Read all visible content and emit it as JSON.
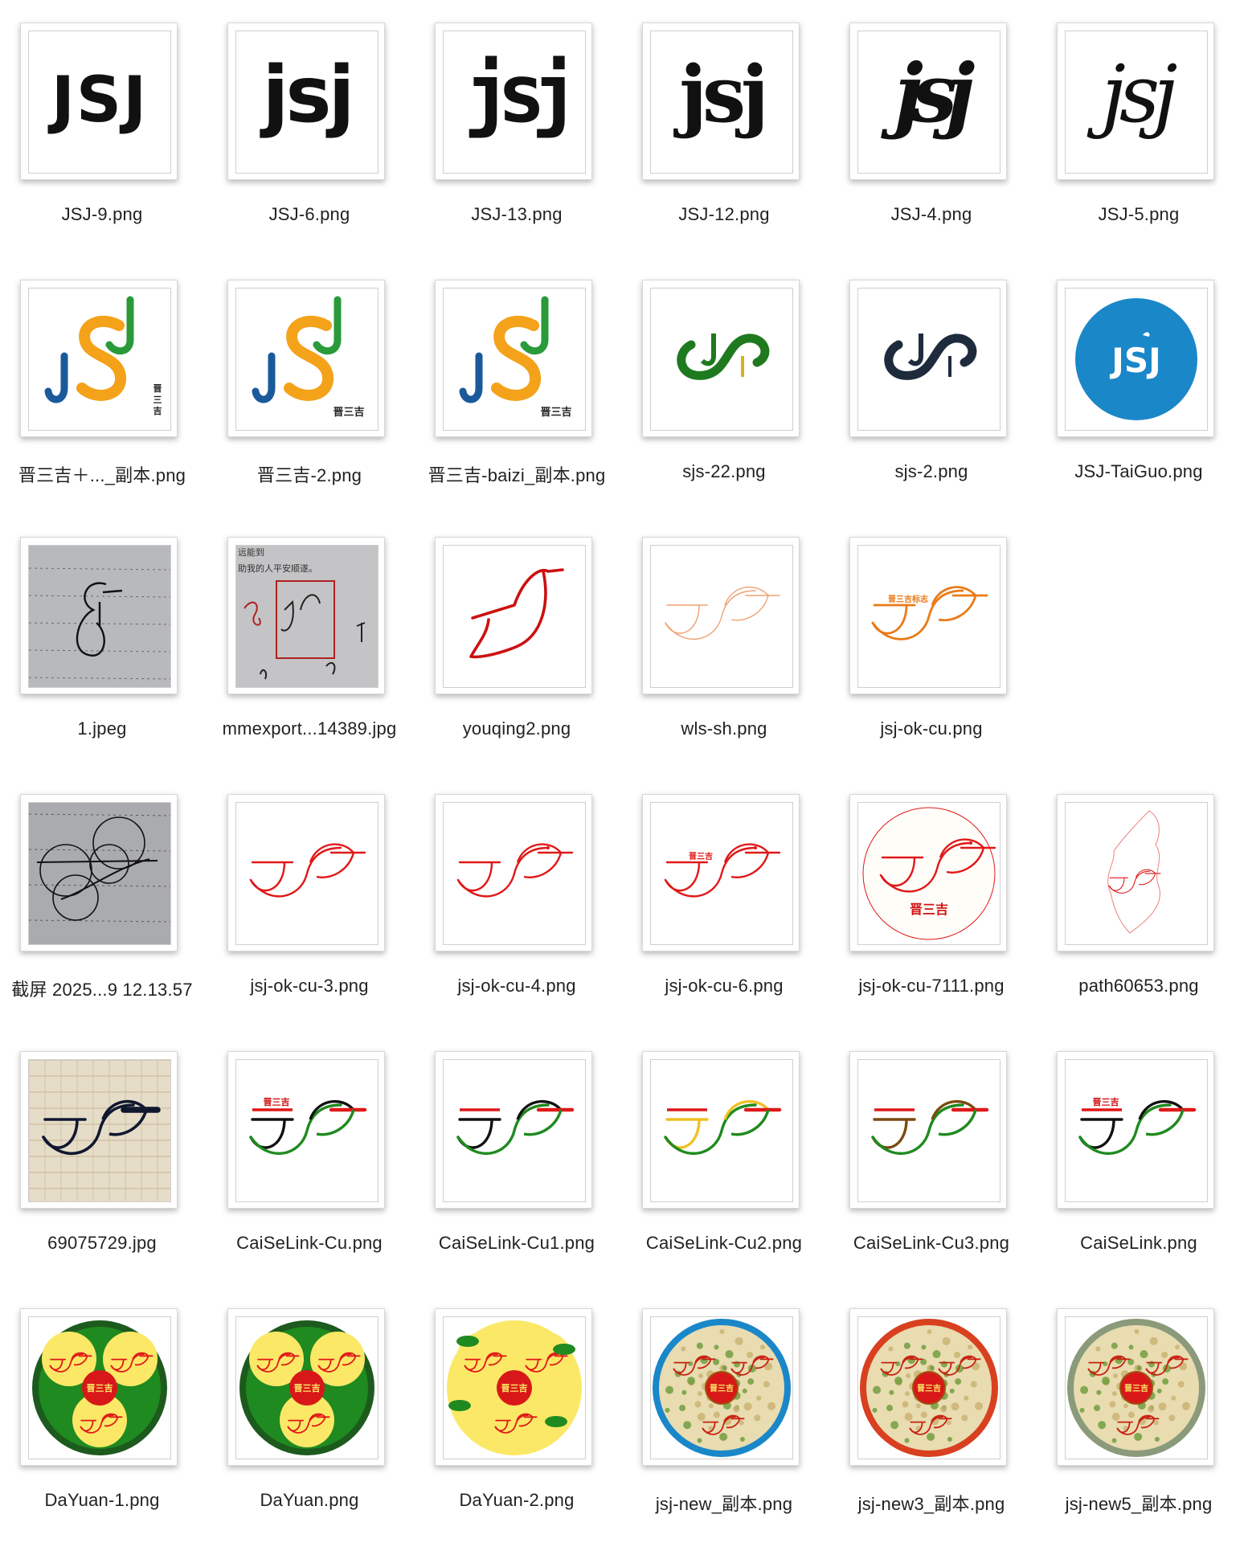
{
  "files": [
    {
      "name": "JSJ-9.png",
      "icon": "jsj-bold-logo-icon",
      "thumb": "text",
      "text": "JSJ",
      "style": "blocky",
      "color": "#111111"
    },
    {
      "name": "JSJ-6.png",
      "icon": "jsj-heavy-lowercase-logo-icon",
      "thumb": "text",
      "text": "jsj",
      "style": "heavy",
      "color": "#111111"
    },
    {
      "name": "JSJ-13.png",
      "icon": "jsj-condensed-logo-icon",
      "thumb": "text",
      "text": "jsj",
      "style": "condensed",
      "color": "#111111"
    },
    {
      "name": "JSJ-12.png",
      "icon": "jsj-rounded-logo-icon",
      "thumb": "text",
      "text": "jsj",
      "style": "rounded",
      "color": "#111111"
    },
    {
      "name": "JSJ-4.png",
      "icon": "jsj-script-logo-icon",
      "thumb": "text",
      "text": "jsj",
      "style": "script",
      "color": "#111111"
    },
    {
      "name": "JSJ-5.png",
      "icon": "jsj-light-script-logo-icon",
      "thumb": "text",
      "text": "jsj",
      "style": "light",
      "color": "#111111"
    },
    {
      "name": "晋三吉＋..._副本.png",
      "icon": "jsj-colored-letters-icon",
      "thumb": "colorjs",
      "caption": "晋三吉",
      "vertical": true
    },
    {
      "name": "晋三吉-2.png",
      "icon": "jsj-colored-letters-icon",
      "thumb": "colorjs",
      "caption": "晋三吉",
      "vertical": false
    },
    {
      "name": "晋三吉-baizi_副本.png",
      "icon": "jsj-colored-letters-icon",
      "thumb": "colorjs",
      "caption": "晋三吉",
      "vertical": false
    },
    {
      "name": "sjs-22.png",
      "icon": "sjs-green-logo-icon",
      "thumb": "sjs",
      "color": "#1f7a1f",
      "accent": "#d8b020"
    },
    {
      "name": "sjs-2.png",
      "icon": "sjs-navy-logo-icon",
      "thumb": "sjs",
      "color": "#1e2b3c",
      "accent": "#1e2b3c"
    },
    {
      "name": "JSJ-TaiGuo.png",
      "icon": "jsj-blue-circle-logo-icon",
      "thumb": "circletext",
      "text": "JSJ",
      "color": "#1a87c9"
    },
    {
      "name": "1.jpeg",
      "icon": "handwritten-sketch-photo-icon",
      "thumb": "photo"
    },
    {
      "name": "mmexport...14389.jpg",
      "icon": "notebook-sketch-photo-icon",
      "thumb": "photo2"
    },
    {
      "name": "youqing2.png",
      "icon": "red-bird-outline-icon",
      "thumb": "redbird"
    },
    {
      "name": "wls-sh.png",
      "icon": "orange-thin-bird-icon",
      "thumb": "bird",
      "color": "#f0a070",
      "width": 1.4
    },
    {
      "name": "jsj-ok-cu.png",
      "icon": "orange-bird-logo-icon",
      "thumb": "bird",
      "color": "#ea7a18",
      "width": 2.8,
      "caption": "晋三吉标志"
    },
    null,
    {
      "name": "截屏 2025...9 12.13.57",
      "icon": "circles-sketch-photo-icon",
      "thumb": "circlesphoto"
    },
    {
      "name": "jsj-ok-cu-3.png",
      "icon": "red-bird-logo-icon",
      "thumb": "bird",
      "color": "#e01818",
      "width": 2.4
    },
    {
      "name": "jsj-ok-cu-4.png",
      "icon": "red-bird-logo-icon",
      "thumb": "bird",
      "color": "#e01818",
      "width": 2.4,
      "eye": true
    },
    {
      "name": "jsj-ok-cu-6.png",
      "icon": "red-bird-logo-icon",
      "thumb": "bird",
      "color": "#e01818",
      "width": 2.4,
      "eye": true,
      "caption": "晋三吉"
    },
    {
      "name": "jsj-ok-cu-7111.png",
      "icon": "red-bird-seal-icon",
      "thumb": "birdcircle",
      "color": "#e01818",
      "caption": "晋三吉"
    },
    {
      "name": "path60653.png",
      "icon": "map-outline-icon",
      "thumb": "map"
    },
    {
      "name": "69075729.jpg",
      "icon": "ink-sketch-photo-icon",
      "thumb": "inkphoto"
    },
    {
      "name": "CaiSeLink-Cu.png",
      "icon": "color-link-bird-icon",
      "thumb": "colorbird",
      "colors": [
        "#111111",
        "#1f8a1f",
        "#e01818"
      ],
      "caption": "晋三吉"
    },
    {
      "name": "CaiSeLink-Cu1.png",
      "icon": "color-link-bird-icon",
      "thumb": "colorbird",
      "colors": [
        "#111111",
        "#1f8a1f",
        "#e01818"
      ]
    },
    {
      "name": "CaiSeLink-Cu2.png",
      "icon": "color-link-bird-icon",
      "thumb": "colorbird",
      "colors": [
        "#f0c020",
        "#1f8a1f",
        "#e01818"
      ]
    },
    {
      "name": "CaiSeLink-Cu3.png",
      "icon": "color-link-bird-icon",
      "thumb": "colorbird",
      "colors": [
        "#7a4a10",
        "#1f8a1f",
        "#e01818"
      ]
    },
    {
      "name": "CaiSeLink.png",
      "icon": "color-link-bird-icon",
      "thumb": "colorbird",
      "colors": [
        "#111111",
        "#1f8a1f",
        "#e01818"
      ],
      "caption": "晋三吉"
    },
    {
      "name": "DaYuan-1.png",
      "icon": "round-emblem-icon",
      "thumb": "emblem",
      "ring": "#1d5a1d",
      "fill": "#1f8a1f",
      "petal": "#fbe866",
      "caption": "晋三吉"
    },
    {
      "name": "DaYuan.png",
      "icon": "round-emblem-icon",
      "thumb": "emblem",
      "ring": "#1d5a1d",
      "fill": "#1f8a1f",
      "petal": "#fbe866",
      "caption": "晋三吉"
    },
    {
      "name": "DaYuan-2.png",
      "icon": "round-emblem-icon",
      "thumb": "emblem",
      "ring": "#fbe866",
      "fill": "#fbe866",
      "petal": "#fbe866",
      "caption": "晋三吉"
    },
    {
      "name": "jsj-new_副本.png",
      "icon": "round-emblem-blue-ring-icon",
      "thumb": "emblem2",
      "ring": "#1a87c9",
      "caption": "晋三吉"
    },
    {
      "name": "jsj-new3_副本.png",
      "icon": "round-emblem-red-ring-icon",
      "thumb": "emblem2",
      "ring": "#d84020",
      "caption": "晋三吉"
    },
    {
      "name": "jsj-new5_副本.png",
      "icon": "round-emblem-silver-ring-icon",
      "thumb": "emblem2",
      "ring": "#8a9a7a",
      "caption": "晋三吉"
    }
  ]
}
